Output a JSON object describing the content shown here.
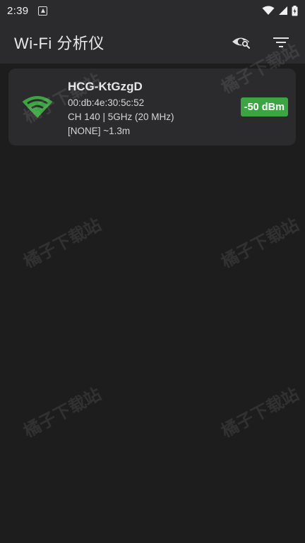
{
  "status_bar": {
    "time": "2:39",
    "icons": [
      "notification-icon",
      "wifi-icon",
      "cellular-icon",
      "battery-icon"
    ]
  },
  "app_bar": {
    "title": "Wi-Fi 分析仪",
    "actions": [
      "visibility-search-icon",
      "filter-icon"
    ]
  },
  "network": {
    "ssid": "HCG-KtGzgD",
    "bssid": "00:db:4e:30:5c:52",
    "channel_info": "CH 140 | 5GHz (20 MHz)",
    "security_distance": "[NONE] ~1.3m",
    "signal": "-50 dBm",
    "signal_icon": "wifi-signal-icon"
  },
  "colors": {
    "background": "#1d1d1d",
    "bar": "#2b2b2e",
    "card": "#2b2b2e",
    "accent_green": "#3ca442"
  },
  "watermark": {
    "text": "橘子下载站"
  }
}
